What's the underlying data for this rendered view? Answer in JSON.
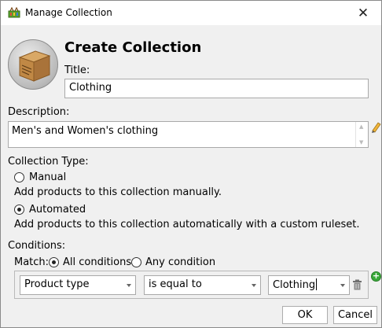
{
  "window": {
    "title": "Manage Collection",
    "close_glyph": "✕"
  },
  "header": {
    "heading": "Create Collection"
  },
  "form": {
    "title_label": "Title:",
    "title_value": "Clothing",
    "description_label": "Description:",
    "description_value": "Men's and Women's clothing"
  },
  "collection_type": {
    "label": "Collection Type:",
    "manual_label": "Manual",
    "manual_desc": "Add products to this collection manually.",
    "automated_label": "Automated",
    "automated_desc": "Add products to this collection automatically with a custom ruleset.",
    "selected": "automated"
  },
  "conditions": {
    "label": "Conditions:",
    "match_label": "Match:",
    "all_label": "All conditions",
    "any_label": "Any condition",
    "selected": "all",
    "rule": {
      "field": "Product type",
      "operator": "is equal to",
      "value": "Clothing"
    }
  },
  "buttons": {
    "ok": "OK",
    "cancel": "Cancel"
  },
  "colors": {
    "window_bg": "#f0f0f0",
    "add_icon": "#3aa93a"
  }
}
